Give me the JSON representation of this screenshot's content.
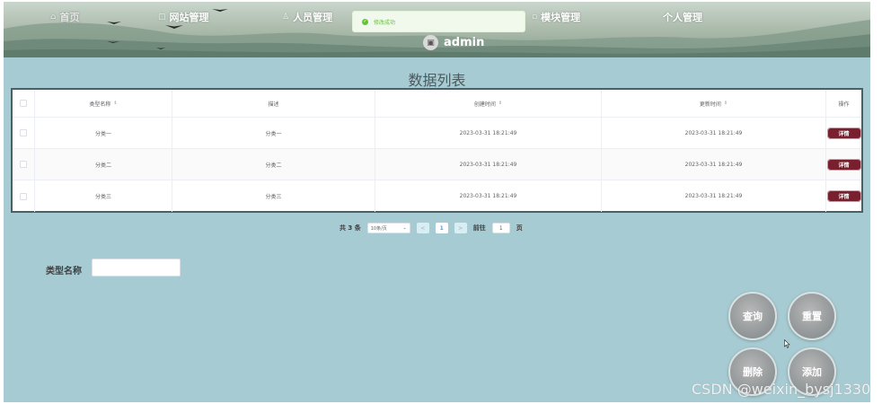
{
  "nav": {
    "home": "首页",
    "site_mgmt": "网站管理",
    "staff_mgmt": "人员管理",
    "module_mgmt": "模块管理",
    "personal_mgmt": "个人管理"
  },
  "user": {
    "name": "admin"
  },
  "toast": {
    "message": "修改成功"
  },
  "page": {
    "title": "数据列表"
  },
  "table": {
    "columns": [
      "类型名称",
      "描述",
      "创建时间",
      "更新时间",
      "操作"
    ],
    "rows": [
      {
        "name": "分类一",
        "desc": "分类一",
        "created": "2023-03-31 18:21:49",
        "updated": "2023-03-31 18:21:49",
        "action": "详情"
      },
      {
        "name": "分类二",
        "desc": "分类二",
        "created": "2023-03-31 18:21:49",
        "updated": "2023-03-31 18:21:49",
        "action": "详情"
      },
      {
        "name": "分类三",
        "desc": "分类三",
        "created": "2023-03-31 18:21:49",
        "updated": "2023-03-31 18:21:49",
        "action": "详情"
      }
    ]
  },
  "pagination": {
    "total_text": "共 3 条",
    "page_size": "10条/页",
    "prev": "<",
    "current_page": "1",
    "next": ">",
    "goto_prefix": "前往",
    "goto_value": "1",
    "goto_suffix": "页"
  },
  "search": {
    "label": "类型名称",
    "value": ""
  },
  "buttons": {
    "query": "查询",
    "reset": "重置",
    "delete": "删除",
    "add": "添加"
  },
  "watermark": "CSDN @weixin_bysj1330",
  "colors": {
    "background": "#a7cbd2",
    "table_border": "#44626a",
    "detail_button": "#7a1f2d",
    "success": "#67c23a"
  }
}
